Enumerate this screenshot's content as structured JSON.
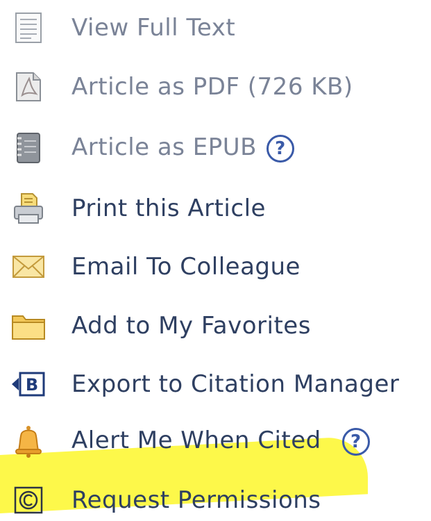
{
  "menu": {
    "items": [
      {
        "label": "View Full Text",
        "icon": "document-lines-icon",
        "enabled": false,
        "help": false
      },
      {
        "label": "Article as PDF (726 KB)",
        "icon": "pdf-icon",
        "enabled": false,
        "help": false
      },
      {
        "label": "Article as EPUB",
        "icon": "epub-book-icon",
        "enabled": false,
        "help": true,
        "help_label": "?"
      },
      {
        "label": "Print this Article",
        "icon": "printer-icon",
        "enabled": true,
        "help": false
      },
      {
        "label": "Email To Colleague",
        "icon": "envelope-icon",
        "enabled": true,
        "help": false
      },
      {
        "label": "Add to My Favorites",
        "icon": "folder-icon",
        "enabled": true,
        "help": false
      },
      {
        "label": "Export to Citation Manager",
        "icon": "citation-export-icon",
        "enabled": true,
        "help": false
      },
      {
        "label": "Alert Me When Cited",
        "icon": "bell-icon",
        "enabled": true,
        "help": true,
        "help_label": "?"
      },
      {
        "label": "Request Permissions",
        "icon": "copyright-icon",
        "enabled": true,
        "help": false
      }
    ]
  },
  "colors": {
    "link": "#2e3f61",
    "disabled_link": "#7a8397",
    "help_icon": "#3a5aa8",
    "highlight": "#fdf84a"
  }
}
